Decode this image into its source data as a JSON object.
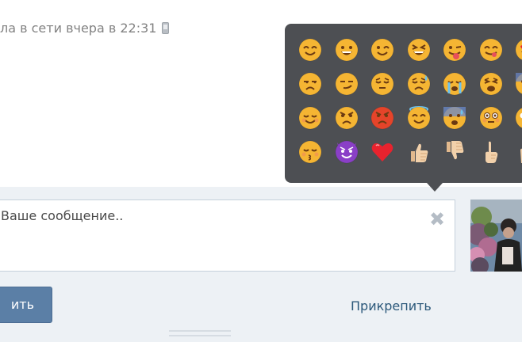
{
  "status": {
    "text": "ла в сети вчера в 22:31",
    "icon": "mobile-phone-icon"
  },
  "composer": {
    "placeholder": "Ваше сообщение..",
    "clear_icon": "✖",
    "send_label": "ить",
    "attach_label": "Прикрепить"
  },
  "emoji_grid": [
    [
      "smile",
      "grin",
      "wink",
      "laugh",
      "tongue-wink",
      "yum",
      "heart-eyes"
    ],
    [
      "unamused",
      "smirk",
      "pensive",
      "disappointed-relieved",
      "sob",
      "weary",
      "cold-sweat"
    ],
    [
      "relieved",
      "angry",
      "rage",
      "innocent",
      "anxious-sweat",
      "flushed",
      "scream"
    ],
    [
      "kissing-closed-eyes",
      "imp",
      "red-heart",
      "thumbs-up",
      "thumbs-down",
      "point-up",
      "raised-hand"
    ]
  ],
  "colors": {
    "popup_bg": "#4d4f53",
    "emoji_yellow": "#f5b533",
    "angry_red": "#e5442a",
    "imp_purple": "#8a3fc7",
    "heart_red": "#e8232e",
    "skin": "#f2d1ab",
    "link": "#2b587a",
    "button": "#5b7fa6"
  }
}
